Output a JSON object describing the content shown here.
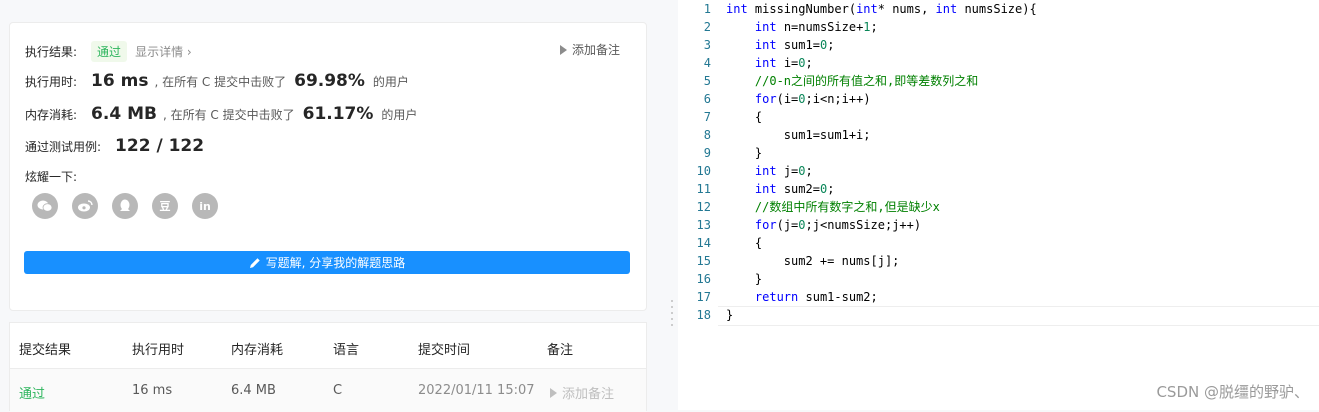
{
  "result": {
    "label": "执行结果:",
    "status": "通过",
    "details_link": "显示详情 ›",
    "add_note": "添加备注"
  },
  "runtime": {
    "label": "执行用时:",
    "value": "16 ms",
    "mid": ", 在所有 C 提交中击败了",
    "percent": "69.98%",
    "suffix": "的用户"
  },
  "memory": {
    "label": "内存消耗:",
    "value": "6.4 MB",
    "mid": ", 在所有 C 提交中击败了",
    "percent": "61.17%",
    "suffix": "的用户"
  },
  "tests": {
    "label": "通过测试用例:",
    "value": "122 / 122"
  },
  "share": {
    "label": "炫耀一下:",
    "icons": [
      "wechat-icon",
      "weibo-icon",
      "qq-icon",
      "douban-icon",
      "linkedin-icon"
    ],
    "douban_glyph": "豆",
    "linkedin_glyph": "in"
  },
  "write_solution": "写题解, 分享我的解题思路",
  "history": {
    "headers": [
      "提交结果",
      "执行用时",
      "内存消耗",
      "语言",
      "提交时间",
      "备注"
    ],
    "rows": [
      {
        "status": "通过",
        "runtime": "16 ms",
        "memory": "6.4 MB",
        "lang": "C",
        "time": "2022/01/11 15:07",
        "note": "添加备注"
      }
    ]
  },
  "editor": {
    "line_numbers": [
      "1",
      "2",
      "3",
      "4",
      "5",
      "6",
      "7",
      "8",
      "9",
      "10",
      "11",
      "12",
      "13",
      "14",
      "15",
      "16",
      "17",
      "18"
    ]
  },
  "colors": {
    "accent": "#1890ff",
    "success": "#2db55d",
    "keyword": "#0000ff",
    "comment": "#008000",
    "number": "#098658",
    "line_number": "#237893"
  },
  "watermark": "CSDN @脱缰的野驴、"
}
